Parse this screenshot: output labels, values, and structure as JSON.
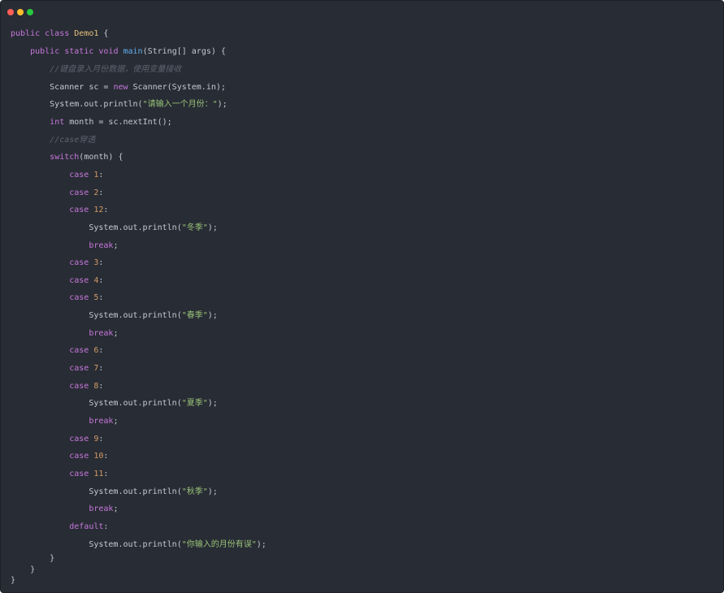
{
  "window": {
    "traffic_lights": [
      {
        "name": "close",
        "color": "#ff5f56"
      },
      {
        "name": "minimize",
        "color": "#ffbd2e"
      },
      {
        "name": "maximize",
        "color": "#27c93f"
      }
    ]
  },
  "code": {
    "lines": [
      {
        "segments": [
          {
            "t": "kw",
            "v": "public class "
          },
          {
            "t": "cls",
            "v": "Demo1"
          },
          {
            "t": "pl",
            "v": " {"
          }
        ]
      },
      {
        "segments": [
          {
            "t": "pl",
            "v": "    "
          },
          {
            "t": "kw",
            "v": "public static void "
          },
          {
            "t": "fn",
            "v": "main"
          },
          {
            "t": "pl",
            "v": "(String[] args) {"
          }
        ]
      },
      {
        "segments": [
          {
            "t": "pl",
            "v": "        "
          },
          {
            "t": "cm",
            "v": "//键盘录入月份数据，使用变量接收"
          }
        ]
      },
      {
        "segments": [
          {
            "t": "pl",
            "v": "        Scanner sc = "
          },
          {
            "t": "kw",
            "v": "new"
          },
          {
            "t": "pl",
            "v": " Scanner(System.in);"
          }
        ]
      },
      {
        "segments": [
          {
            "t": "pl",
            "v": "        System.out.println("
          },
          {
            "t": "str",
            "v": "\"请输入一个月份：\""
          },
          {
            "t": "pl",
            "v": ");"
          }
        ]
      },
      {
        "segments": [
          {
            "t": "pl",
            "v": "        "
          },
          {
            "t": "kw",
            "v": "int"
          },
          {
            "t": "pl",
            "v": " month = sc.nextInt();"
          }
        ]
      },
      {
        "segments": [
          {
            "t": "pl",
            "v": "        "
          },
          {
            "t": "cm",
            "v": "//case穿透"
          }
        ]
      },
      {
        "segments": [
          {
            "t": "pl",
            "v": "        "
          },
          {
            "t": "kw",
            "v": "switch"
          },
          {
            "t": "pl",
            "v": "(month) {"
          }
        ]
      },
      {
        "segments": [
          {
            "t": "pl",
            "v": "            "
          },
          {
            "t": "kw",
            "v": "case "
          },
          {
            "t": "num",
            "v": "1"
          },
          {
            "t": "pl",
            "v": ":"
          }
        ]
      },
      {
        "segments": [
          {
            "t": "pl",
            "v": "            "
          },
          {
            "t": "kw",
            "v": "case "
          },
          {
            "t": "num",
            "v": "2"
          },
          {
            "t": "pl",
            "v": ":"
          }
        ]
      },
      {
        "segments": [
          {
            "t": "pl",
            "v": "            "
          },
          {
            "t": "kw",
            "v": "case "
          },
          {
            "t": "num",
            "v": "12"
          },
          {
            "t": "pl",
            "v": ":"
          }
        ]
      },
      {
        "segments": [
          {
            "t": "pl",
            "v": "                System.out.println("
          },
          {
            "t": "str",
            "v": "\"冬季\""
          },
          {
            "t": "pl",
            "v": ");"
          }
        ]
      },
      {
        "segments": [
          {
            "t": "pl",
            "v": "                "
          },
          {
            "t": "kw",
            "v": "break"
          },
          {
            "t": "pl",
            "v": ";"
          }
        ]
      },
      {
        "segments": [
          {
            "t": "pl",
            "v": "            "
          },
          {
            "t": "kw",
            "v": "case "
          },
          {
            "t": "num",
            "v": "3"
          },
          {
            "t": "pl",
            "v": ":"
          }
        ]
      },
      {
        "segments": [
          {
            "t": "pl",
            "v": "            "
          },
          {
            "t": "kw",
            "v": "case "
          },
          {
            "t": "num",
            "v": "4"
          },
          {
            "t": "pl",
            "v": ":"
          }
        ]
      },
      {
        "segments": [
          {
            "t": "pl",
            "v": "            "
          },
          {
            "t": "kw",
            "v": "case "
          },
          {
            "t": "num",
            "v": "5"
          },
          {
            "t": "pl",
            "v": ":"
          }
        ]
      },
      {
        "segments": [
          {
            "t": "pl",
            "v": "                System.out.println("
          },
          {
            "t": "str",
            "v": "\"春季\""
          },
          {
            "t": "pl",
            "v": ");"
          }
        ]
      },
      {
        "segments": [
          {
            "t": "pl",
            "v": "                "
          },
          {
            "t": "kw",
            "v": "break"
          },
          {
            "t": "pl",
            "v": ";"
          }
        ]
      },
      {
        "segments": [
          {
            "t": "pl",
            "v": "            "
          },
          {
            "t": "kw",
            "v": "case "
          },
          {
            "t": "num",
            "v": "6"
          },
          {
            "t": "pl",
            "v": ":"
          }
        ]
      },
      {
        "segments": [
          {
            "t": "pl",
            "v": "            "
          },
          {
            "t": "kw",
            "v": "case "
          },
          {
            "t": "num",
            "v": "7"
          },
          {
            "t": "pl",
            "v": ":"
          }
        ]
      },
      {
        "segments": [
          {
            "t": "pl",
            "v": "            "
          },
          {
            "t": "kw",
            "v": "case "
          },
          {
            "t": "num",
            "v": "8"
          },
          {
            "t": "pl",
            "v": ":"
          }
        ]
      },
      {
        "segments": [
          {
            "t": "pl",
            "v": "                System.out.println("
          },
          {
            "t": "str",
            "v": "\"夏季\""
          },
          {
            "t": "pl",
            "v": ");"
          }
        ]
      },
      {
        "segments": [
          {
            "t": "pl",
            "v": "                "
          },
          {
            "t": "kw",
            "v": "break"
          },
          {
            "t": "pl",
            "v": ";"
          }
        ]
      },
      {
        "segments": [
          {
            "t": "pl",
            "v": "            "
          },
          {
            "t": "kw",
            "v": "case "
          },
          {
            "t": "num",
            "v": "9"
          },
          {
            "t": "pl",
            "v": ":"
          }
        ]
      },
      {
        "segments": [
          {
            "t": "pl",
            "v": "            "
          },
          {
            "t": "kw",
            "v": "case "
          },
          {
            "t": "num",
            "v": "10"
          },
          {
            "t": "pl",
            "v": ":"
          }
        ]
      },
      {
        "segments": [
          {
            "t": "pl",
            "v": "            "
          },
          {
            "t": "kw",
            "v": "case "
          },
          {
            "t": "num",
            "v": "11"
          },
          {
            "t": "pl",
            "v": ":"
          }
        ]
      },
      {
        "segments": [
          {
            "t": "pl",
            "v": "                System.out.println("
          },
          {
            "t": "str",
            "v": "\"秋季\""
          },
          {
            "t": "pl",
            "v": ");"
          }
        ]
      },
      {
        "segments": [
          {
            "t": "pl",
            "v": "                "
          },
          {
            "t": "kw",
            "v": "break"
          },
          {
            "t": "pl",
            "v": ";"
          }
        ]
      },
      {
        "segments": [
          {
            "t": "pl",
            "v": "            "
          },
          {
            "t": "kw",
            "v": "default"
          },
          {
            "t": "pl",
            "v": ":"
          }
        ]
      },
      {
        "segments": [
          {
            "t": "pl",
            "v": "                System.out.println("
          },
          {
            "t": "str",
            "v": "\"你输入的月份有误\""
          },
          {
            "t": "pl",
            "v": ");"
          }
        ]
      },
      {
        "segments": [
          {
            "t": "pl",
            "v": "        }"
          }
        ]
      },
      {
        "segments": [
          {
            "t": "pl",
            "v": "    }"
          }
        ]
      },
      {
        "segments": [
          {
            "t": "pl",
            "v": "}"
          }
        ]
      }
    ]
  }
}
